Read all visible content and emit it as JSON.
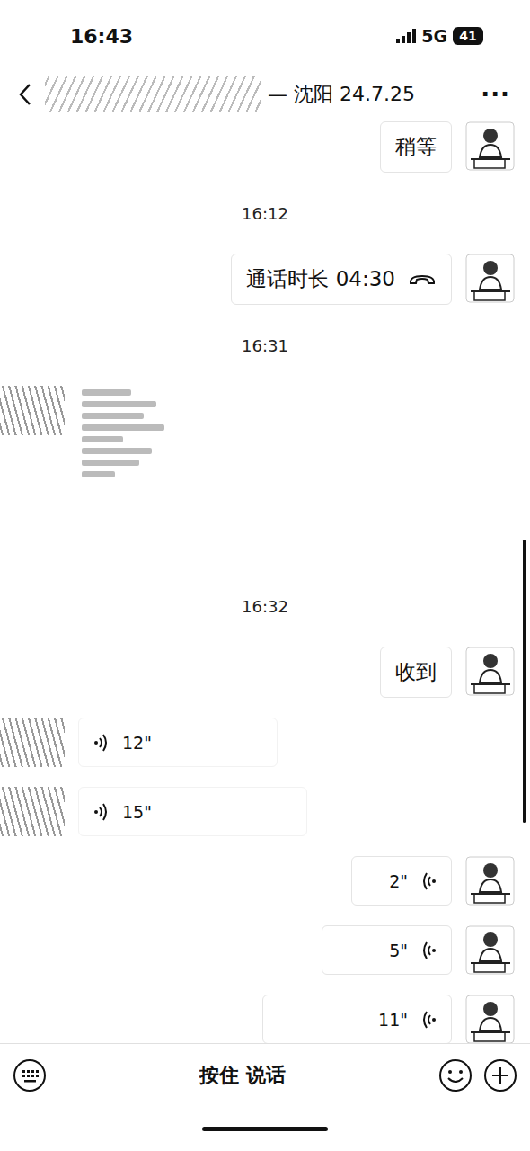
{
  "status_bar": {
    "time": "16:43",
    "network": "5G",
    "battery": "41"
  },
  "nav": {
    "title": "— 沈阳 24.7.25",
    "more": "···"
  },
  "messages": [
    {
      "kind": "text",
      "outgoing": true,
      "text": "稍等"
    },
    {
      "kind": "time",
      "text": "16:12"
    },
    {
      "kind": "call",
      "outgoing": true,
      "text": "通话时长 04:30"
    },
    {
      "kind": "time",
      "text": "16:31"
    },
    {
      "kind": "image",
      "outgoing": false
    },
    {
      "kind": "time",
      "text": "16:32"
    },
    {
      "kind": "text",
      "outgoing": true,
      "text": "收到"
    },
    {
      "kind": "voice",
      "outgoing": false,
      "duration": "12\""
    },
    {
      "kind": "voice",
      "outgoing": false,
      "duration": "15\""
    },
    {
      "kind": "voice",
      "outgoing": true,
      "duration": "2\""
    },
    {
      "kind": "voice",
      "outgoing": true,
      "duration": "5\""
    },
    {
      "kind": "voice",
      "outgoing": true,
      "duration": "11\""
    }
  ],
  "input_bar": {
    "hold_to_talk": "按住 说话"
  }
}
